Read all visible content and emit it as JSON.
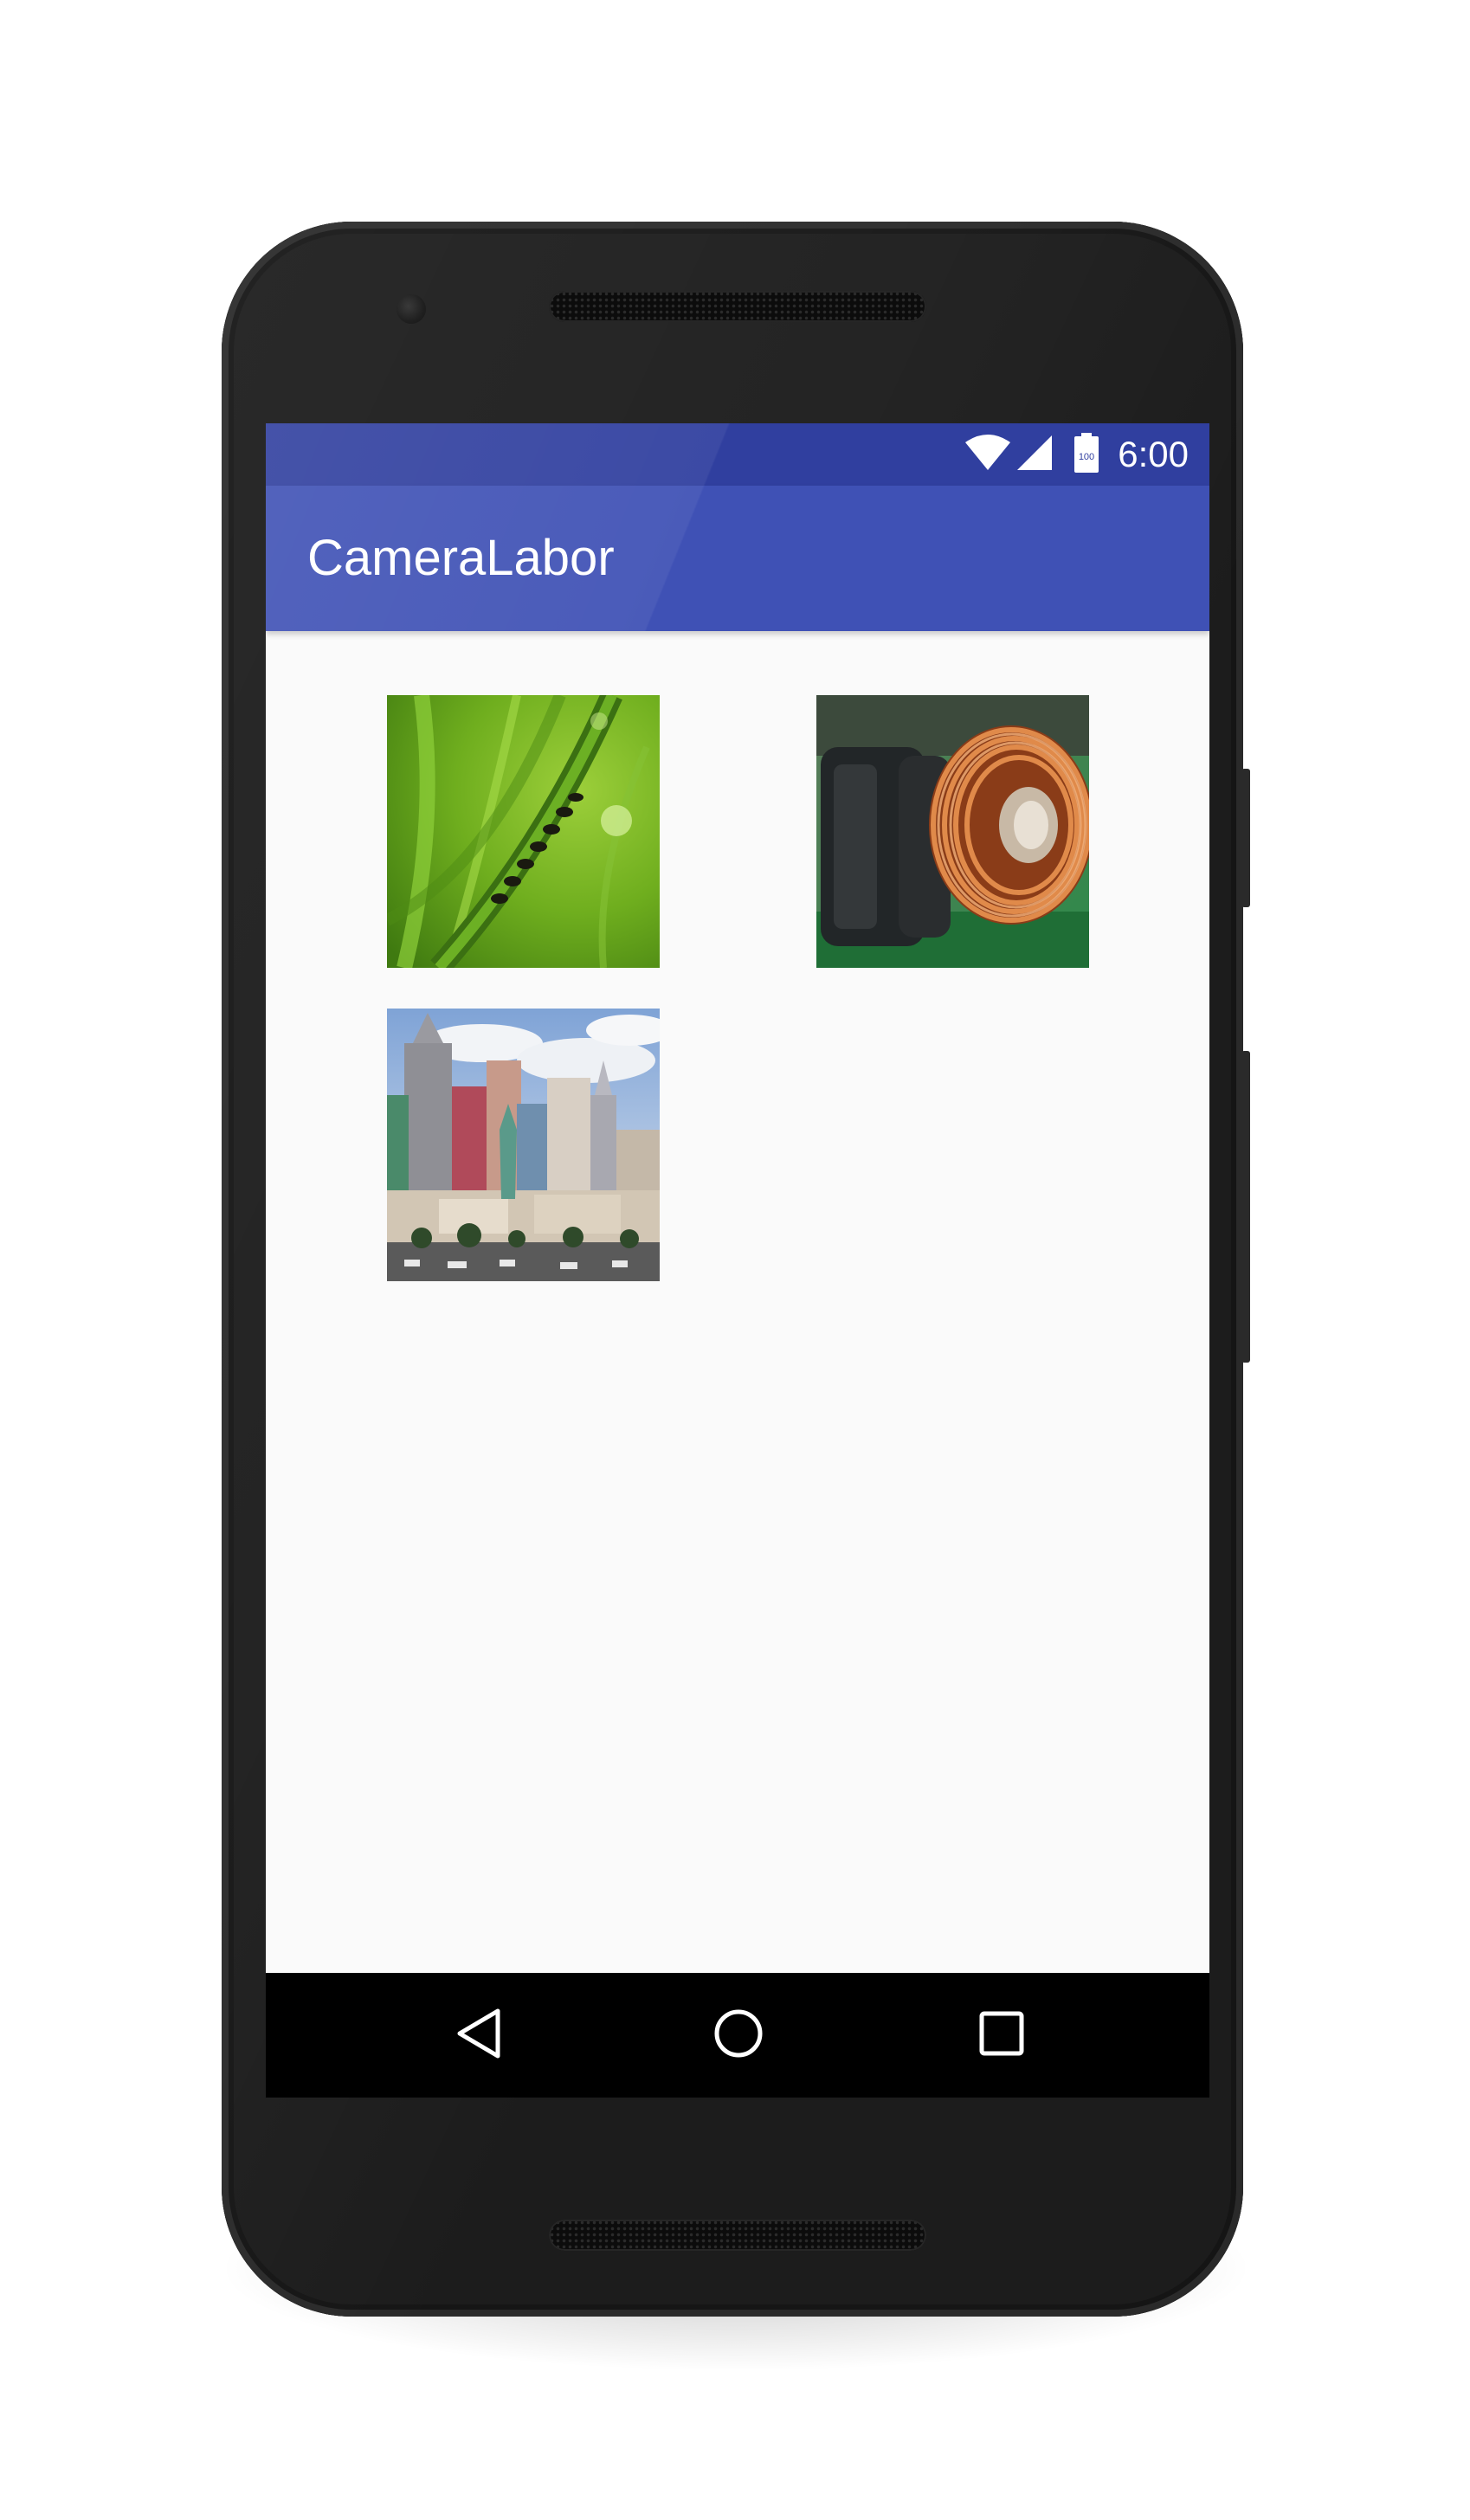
{
  "status_bar": {
    "time": "6:00",
    "battery_label": "100",
    "icons": [
      "wifi-icon",
      "cell-signal-icon",
      "battery-icon"
    ]
  },
  "app_bar": {
    "title": "CameraLabor"
  },
  "gallery": {
    "images": [
      {
        "name": "photo-grass-ants",
        "subject": "ants on grass blade"
      },
      {
        "name": "photo-copper-coil",
        "subject": "copper toroid coil on circuit board"
      },
      {
        "name": "photo-city-skyline",
        "subject": "city skyline with statue"
      }
    ]
  },
  "nav_bar": {
    "buttons": [
      "back-icon",
      "home-icon",
      "recents-icon"
    ]
  },
  "colors": {
    "primary": "#3f51b5",
    "primary_dark": "#303f9f",
    "background": "#fafafa",
    "nav_bar": "#000000"
  }
}
